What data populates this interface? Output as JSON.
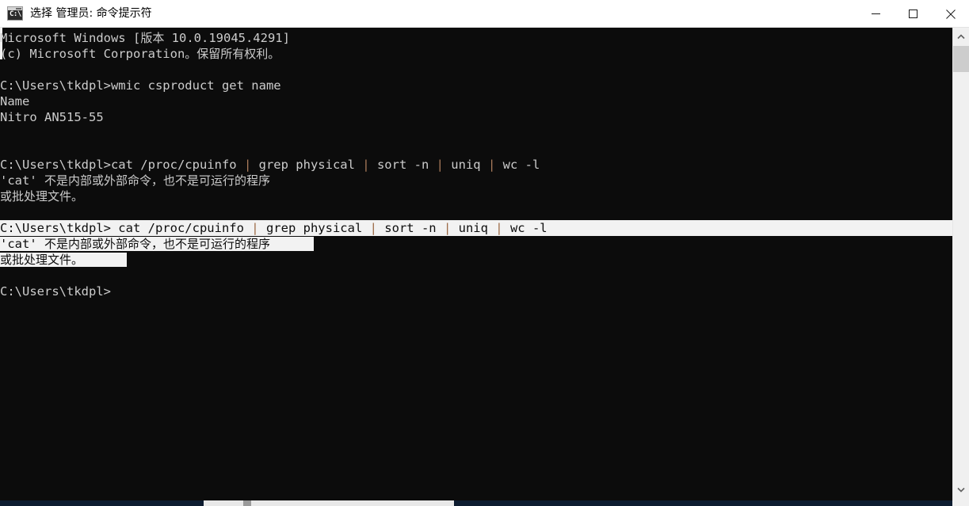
{
  "window": {
    "title": "选择 管理员: 命令提示符",
    "icon": "cmd-console-icon",
    "icon_glyph": "C:\\",
    "controls": {
      "minimize": "minimize-icon",
      "maximize": "maximize-icon",
      "close": "close-icon"
    },
    "colors": {
      "titlebar_bg": "#ffffff",
      "title_text": "#000000",
      "console_bg": "#0c0c0c",
      "console_text": "#cccccc",
      "selection_bg": "#f2f2f2",
      "selection_text": "#0c0c0c",
      "pipe_color": "#a87a5a",
      "scrollbar_track": "#f0f0f0",
      "scrollbar_thumb": "#cdcdcd"
    }
  },
  "console": {
    "lines": [
      {
        "id": "line-version",
        "text": "Microsoft Windows [版本 10.0.19045.4291]",
        "selected": false
      },
      {
        "id": "line-copyright",
        "text": "(c) Microsoft Corporation。保留所有权利。",
        "selected": false
      },
      {
        "id": "line-blank-1",
        "text": "",
        "selected": false
      },
      {
        "id": "line-cmd-wmic",
        "text": "C:\\Users\\tkdpl>wmic csproduct get name",
        "selected": false
      },
      {
        "id": "line-out-name",
        "text": "Name",
        "selected": false
      },
      {
        "id": "line-out-nitro",
        "text": "Nitro AN515-55",
        "selected": false
      },
      {
        "id": "line-blank-2",
        "text": "",
        "selected": false
      },
      {
        "id": "line-blank-3",
        "text": "",
        "selected": false
      },
      {
        "id": "line-cmd-cat",
        "text": "C:\\Users\\tkdpl>cat /proc/cpuinfo | grep physical | sort -n | uniq | wc -l",
        "selected": false
      },
      {
        "id": "line-err-1",
        "text": "'cat' 不是内部或外部命令，也不是可运行的程序",
        "selected": false
      },
      {
        "id": "line-err-2",
        "text": "或批处理文件。",
        "selected": false
      },
      {
        "id": "line-blank-4",
        "text": "",
        "selected": false
      },
      {
        "id": "line-cmd-cat-sel",
        "text": "C:\\Users\\tkdpl> cat /proc/cpuinfo | grep physical | sort -n | uniq | wc -l",
        "selected": true
      },
      {
        "id": "line-err-1-sel",
        "text": "'cat' 不是内部或外部命令，也不是可运行的程序",
        "selected": true
      },
      {
        "id": "line-err-2-sel",
        "text": "或批处理文件。",
        "selected": true
      },
      {
        "id": "line-blank-5",
        "text": "",
        "selected": false
      },
      {
        "id": "line-prompt",
        "text": "C:\\Users\\tkdpl>",
        "selected": false
      }
    ],
    "prompt_path": "C:\\Users\\tkdpl",
    "commands": [
      "wmic csproduct get name",
      "cat /proc/cpuinfo | grep physical | sort -n | uniq | wc -l"
    ],
    "machine_name": "Nitro AN515-55",
    "error_message": "'cat' 不是内部或外部命令，也不是可运行的程序或批处理文件。"
  },
  "scrollbars": {
    "vertical": {
      "up_arrow": "chevron-up-icon",
      "down_arrow": "chevron-down-icon",
      "thumb": "scroll-thumb"
    },
    "horizontal": {
      "thumb": "scroll-thumb"
    }
  }
}
